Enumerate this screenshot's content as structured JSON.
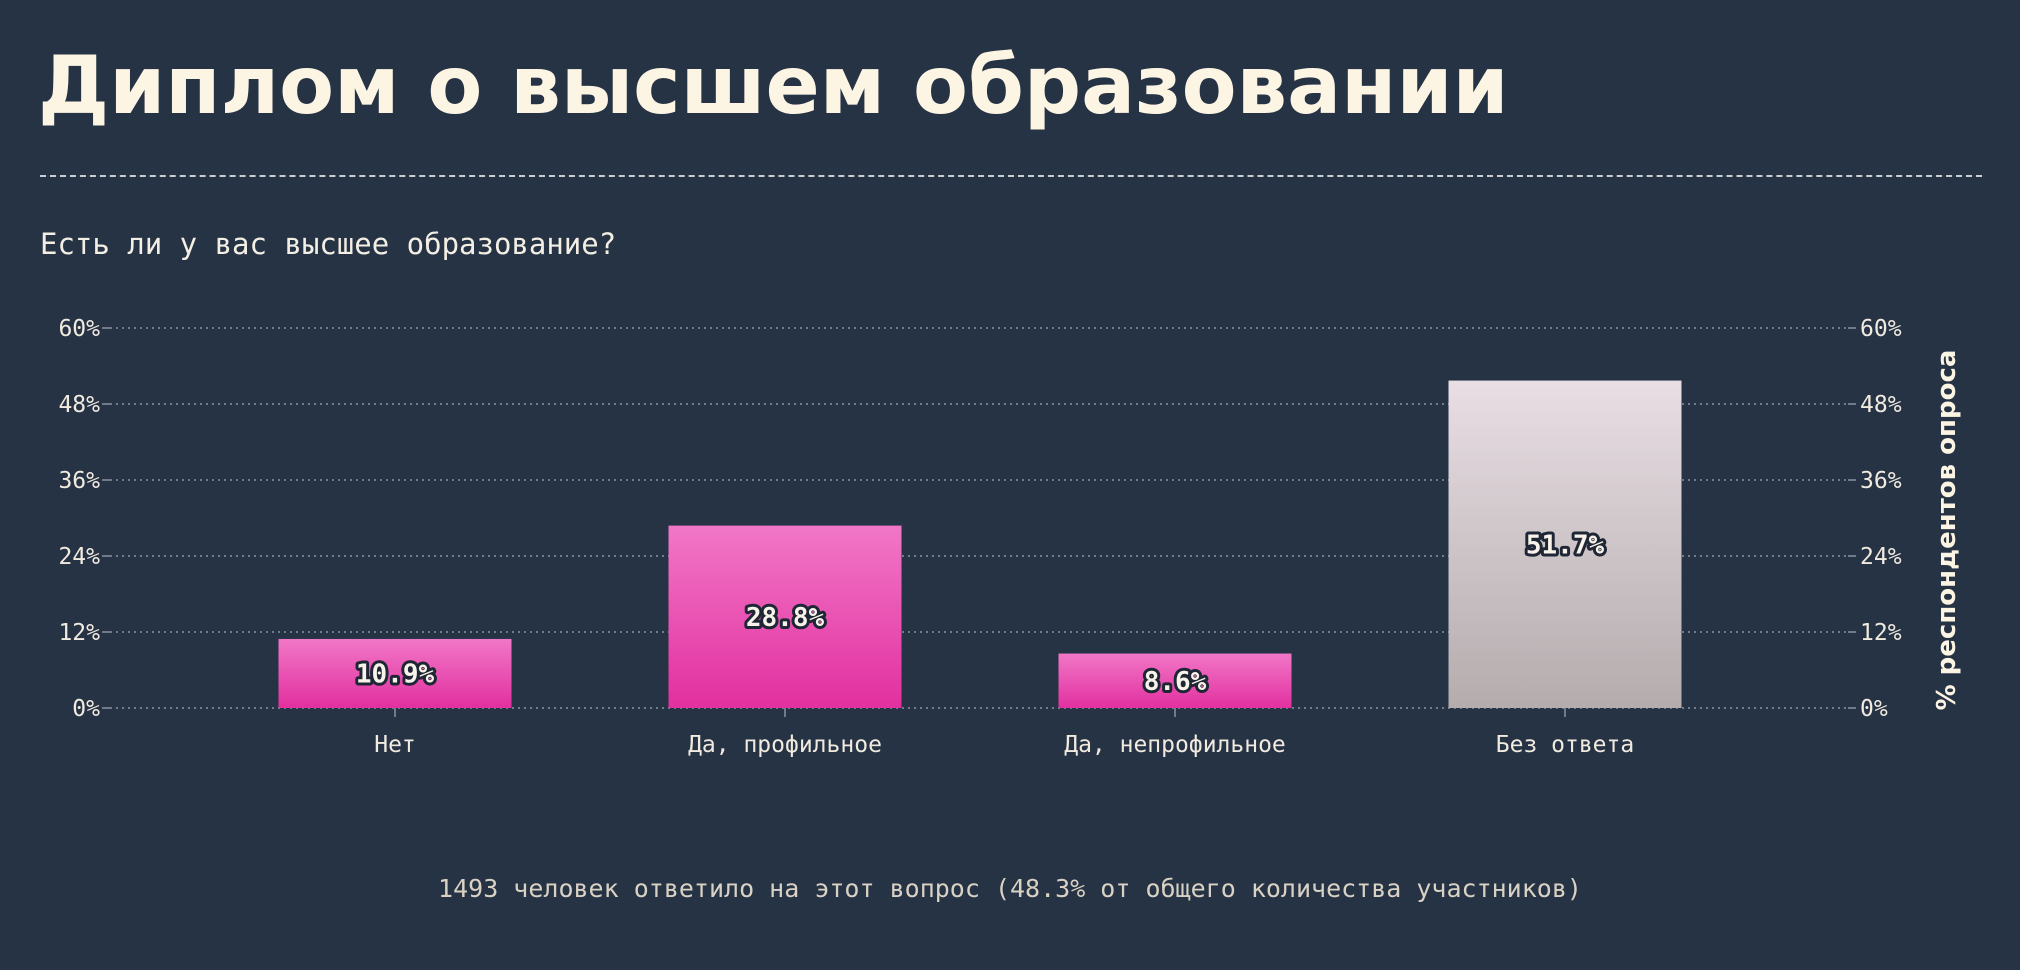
{
  "title": "Диплом о высшем образовании",
  "subtitle": "Есть ли у вас высшее образование?",
  "footnote": "1493 человек ответило на этот вопрос (48.3% от общего количества участников)",
  "chart_data": {
    "type": "bar",
    "categories": [
      "Нет",
      "Да, профильное",
      "Да, непрофильное",
      "Без ответа"
    ],
    "values": [
      10.9,
      28.8,
      8.6,
      51.7
    ],
    "value_labels": [
      "10.9%",
      "28.8%",
      "8.6%",
      "51.7%"
    ],
    "title": "",
    "xlabel": "",
    "ylabel": "% респондентов опроса",
    "ylim": [
      0,
      60
    ],
    "yticks": [
      0,
      12,
      24,
      36,
      48,
      60
    ],
    "ytick_labels": [
      "0%",
      "12%",
      "24%",
      "36%",
      "48%",
      "60%"
    ],
    "grid": true,
    "legend": "none",
    "bar_styles": [
      "pink",
      "pink",
      "pink",
      "grey"
    ],
    "colors": {
      "pink_top": "#f177c7",
      "pink_bottom": "#e2309f",
      "grey_top": "#e8dee4",
      "grey_bottom": "#b4acad",
      "grid": "#8b93a0",
      "background": "#263345"
    }
  }
}
